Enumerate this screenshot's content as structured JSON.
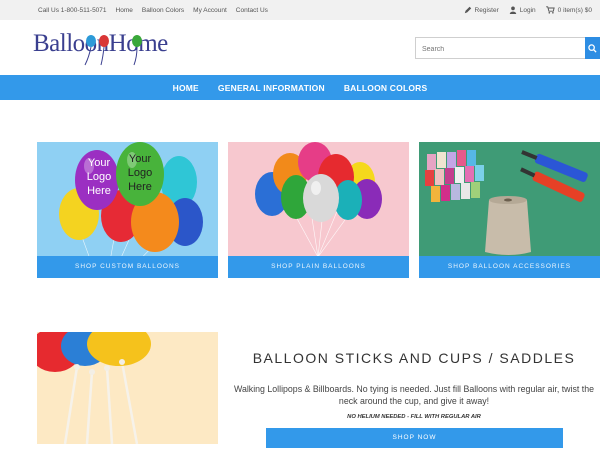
{
  "topbar": {
    "call": "Call Us 1-800-511-5071",
    "links": [
      "Home",
      "Balloon Colors",
      "My Account",
      "Contact Us"
    ],
    "register": "Register",
    "login": "Login",
    "cart": "0 item(s) $0"
  },
  "header": {
    "logo_text": "BalloonHome",
    "search_placeholder": "Search"
  },
  "nav": {
    "items": [
      "HOME",
      "GENERAL INFORMATION",
      "BALLOON COLORS"
    ]
  },
  "tiles": [
    {
      "label": "SHOP CUSTOM BALLOONS",
      "logo_line1": "Your",
      "logo_line2": "Logo",
      "logo_line3": "Here"
    },
    {
      "label": "SHOP PLAIN BALLOONS"
    },
    {
      "label": "SHOP BALLOON ACCESSORIES"
    }
  ],
  "feature": {
    "title": "BALLOON STICKS AND CUPS / SADDLES",
    "description": "Walking Lollipops & Billboards. No tying is needed. Just fill Balloons with regular air, twist the neck around the cup, and give it away!",
    "note": "NO HELIUM NEEDED - FILL WITH REGULAR AIR",
    "button": "SHOP NOW"
  },
  "colors": {
    "accent": "#3399ea",
    "logo": "#3a3f8f",
    "topbar_bg": "#f1f1f1"
  }
}
